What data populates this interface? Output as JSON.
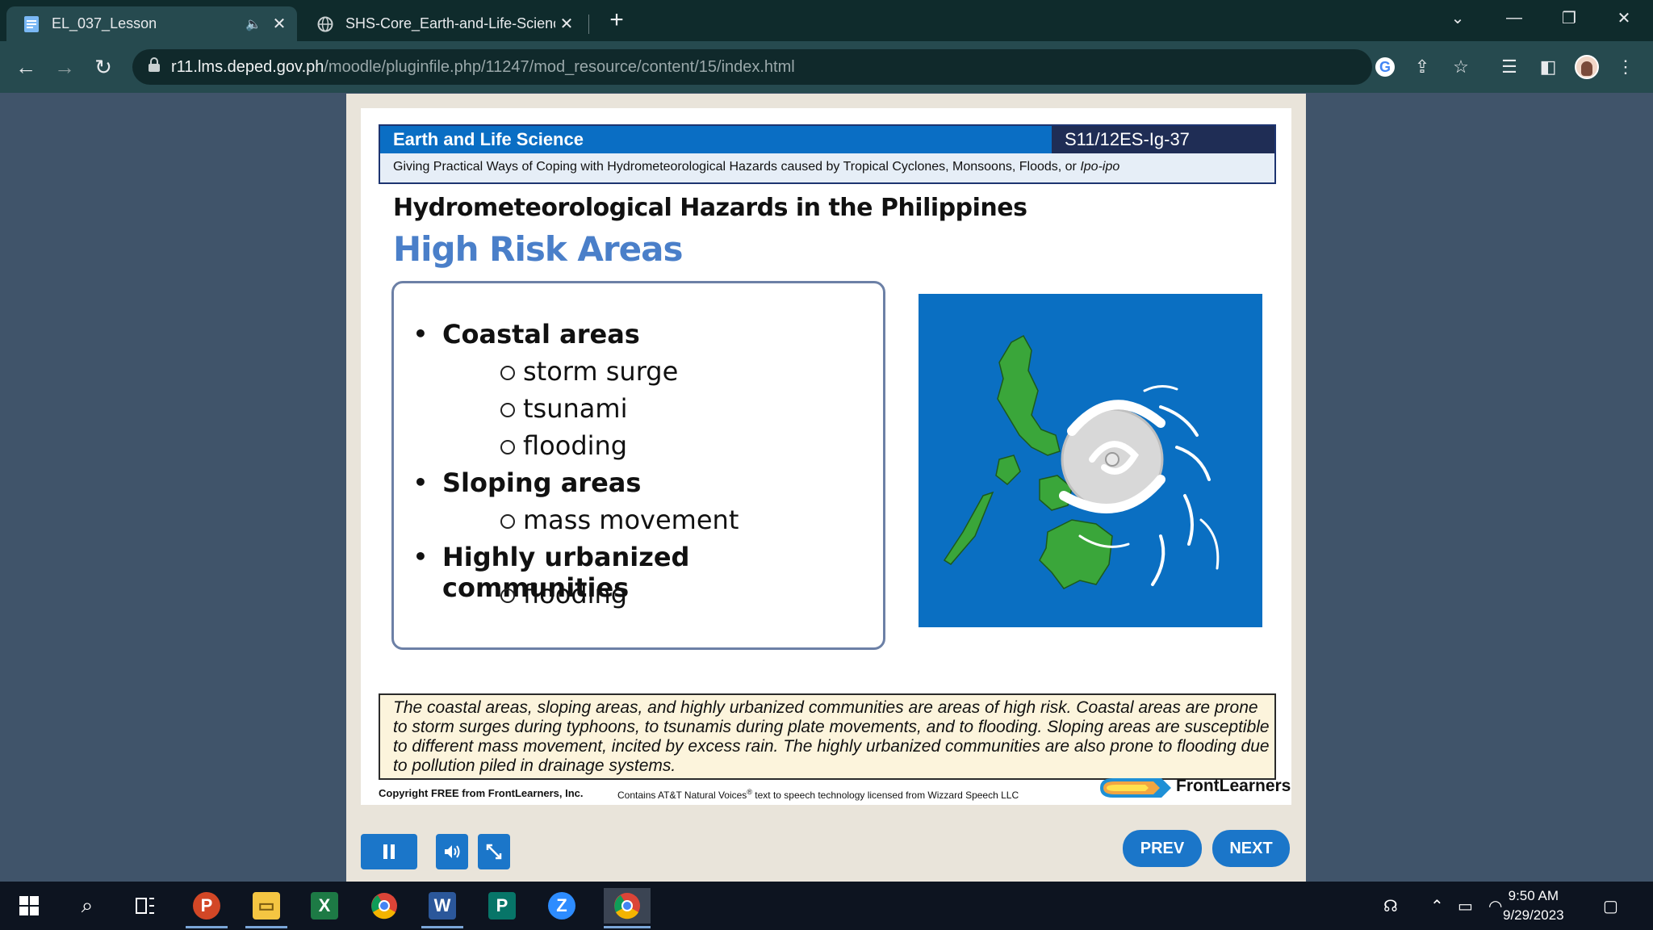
{
  "browser": {
    "tabs": [
      {
        "title": "EL_037_Lesson",
        "active": true
      },
      {
        "title": "SHS-Core_Earth-and-Life-Scienc",
        "active": false
      }
    ],
    "url_host": "r11.lms.deped.gov.ph",
    "url_path": "/moodle/pluginfile.php/11247/mod_resource/content/15/index.html"
  },
  "slide": {
    "subject": "Earth and Life Science",
    "code": "S11/12ES-Ig-37",
    "competency_main": "Giving Practical Ways of Coping with Hydrometeorological Hazards caused by Tropical Cyclones, Monsoons, Floods, or ",
    "competency_italic": "Ipo-ipo",
    "heading": "Hydrometeorological Hazards in the Philippines",
    "subheading": "High Risk Areas",
    "list": [
      {
        "label": "Coastal areas",
        "children": [
          "storm surge",
          "tsunami",
          "flooding"
        ]
      },
      {
        "label": "Sloping areas",
        "children": [
          "mass movement"
        ]
      },
      {
        "label": "Highly urbanized communities",
        "children": [
          "flooding"
        ]
      }
    ],
    "narration": "The coastal areas, sloping areas, and highly urbanized communities are areas of high risk. Coastal areas are prone to storm surges during typhoons, to tsunamis during plate movements, and to flooding. Sloping areas are susceptible to different mass movement, incited by excess rain. The highly urbanized communities are also prone to flooding due to pollution piled in drainage systems.",
    "copyright": "Copyright FREE from FrontLearners, Inc.",
    "tts_prefix": "Contains AT&T Natural Voices",
    "tts_sup": "®",
    "tts_suffix": " text to speech technology licensed from Wizzard Speech LLC",
    "brand": "FrontLearners"
  },
  "controls": {
    "prev": "PREV",
    "next": "NEXT"
  },
  "taskbar": {
    "time": "9:50 AM",
    "date": "9/29/2023"
  },
  "colors": {
    "header_blue": "#0a6ec4",
    "sea": "#0a6fc2",
    "land": "#3aa63a",
    "button": "#1b76c9"
  }
}
